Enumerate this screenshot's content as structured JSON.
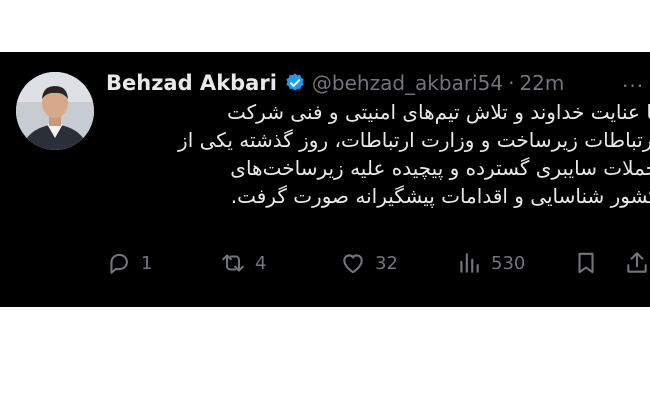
{
  "tweet": {
    "author_name": "Behzad Akbari",
    "handle": "@behzad_akbari54",
    "separator": "·",
    "time": "22m",
    "more": "···",
    "text_lines": [
      "با عنایت خداوند و تلاش تیم‌های امنیتی و فنی شرکت",
      "ارتباطات زیرساخت و وزارت ارتباطات، روز گذشته یکی از",
      "حملات سایبری گسترده و پیچیده علیه زیرساخت‌های",
      "کشور شناسایی و اقدامات پیشگیرانه صورت گرفت."
    ],
    "replies": "1",
    "reposts": "4",
    "likes": "32",
    "views": "530"
  },
  "colors": {
    "background": "#000000",
    "text": "#e7e9ea",
    "muted": "#71767b",
    "verified": "#1d9bf0"
  },
  "icons": [
    "verified-badge-icon",
    "reply-icon",
    "repost-icon",
    "like-icon",
    "views-icon",
    "bookmark-icon",
    "share-icon"
  ]
}
